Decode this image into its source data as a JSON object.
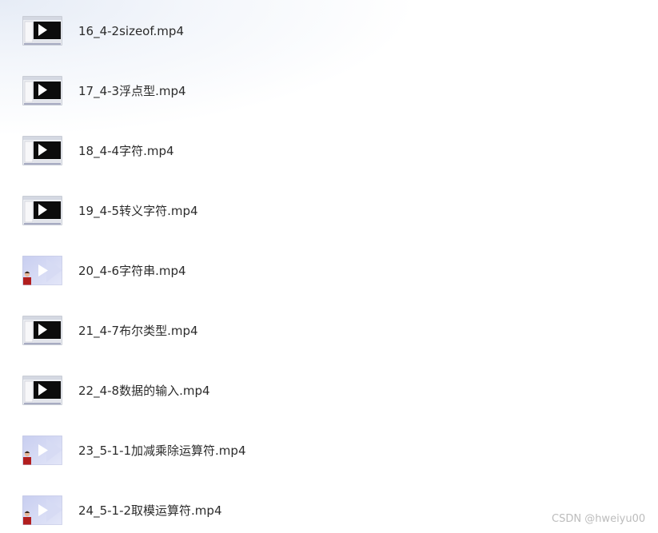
{
  "files": [
    {
      "name": "16_4-2sizeof.mp4",
      "thumb": "screen-video-thumbnail"
    },
    {
      "name": "17_4-3浮点型.mp4",
      "thumb": "screen-video-thumbnail"
    },
    {
      "name": "18_4-4字符.mp4",
      "thumb": "screen-video-thumbnail"
    },
    {
      "name": "19_4-5转义字符.mp4",
      "thumb": "screen-video-thumbnail"
    },
    {
      "name": "20_4-6字符串.mp4",
      "thumb": "lecturer-video-thumbnail"
    },
    {
      "name": "21_4-7布尔类型.mp4",
      "thumb": "screen-video-thumbnail"
    },
    {
      "name": "22_4-8数据的输入.mp4",
      "thumb": "screen-video-thumbnail"
    },
    {
      "name": "23_5-1-1加减乘除运算符.mp4",
      "thumb": "lecturer-video-thumbnail"
    },
    {
      "name": "24_5-1-2取模运算符.mp4",
      "thumb": "lecturer-video-thumbnail"
    }
  ],
  "watermark": "CSDN @hweiyu00"
}
